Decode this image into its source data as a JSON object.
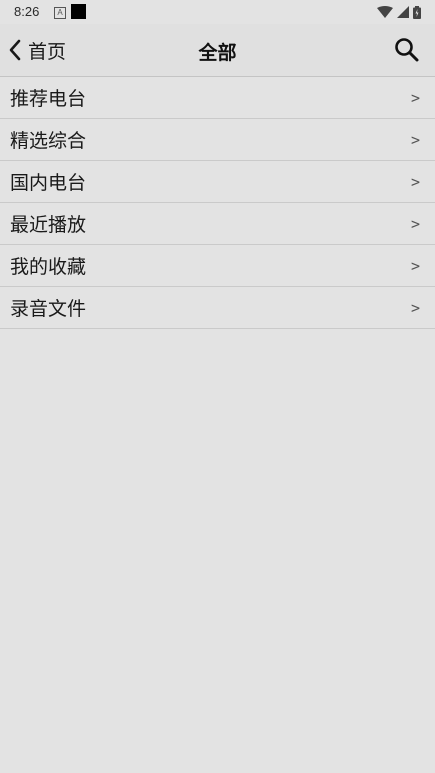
{
  "status_bar": {
    "time": "8:26",
    "notification_icon": "a-icon",
    "icons": [
      "wifi-icon",
      "signal-icon",
      "battery-icon"
    ]
  },
  "header": {
    "back_label": "首页",
    "title": "全部",
    "search_icon": "search-icon"
  },
  "list": {
    "items": [
      {
        "label": "推荐电台",
        "arrow": ">"
      },
      {
        "label": "精选综合",
        "arrow": ">"
      },
      {
        "label": "国内电台",
        "arrow": ">"
      },
      {
        "label": "最近播放",
        "arrow": ">"
      },
      {
        "label": "我的收藏",
        "arrow": ">"
      },
      {
        "label": "录音文件",
        "arrow": ">"
      }
    ]
  },
  "colors": {
    "background": "#e3e3e3",
    "divider": "#cacaca",
    "text": "#1a1a1a"
  }
}
